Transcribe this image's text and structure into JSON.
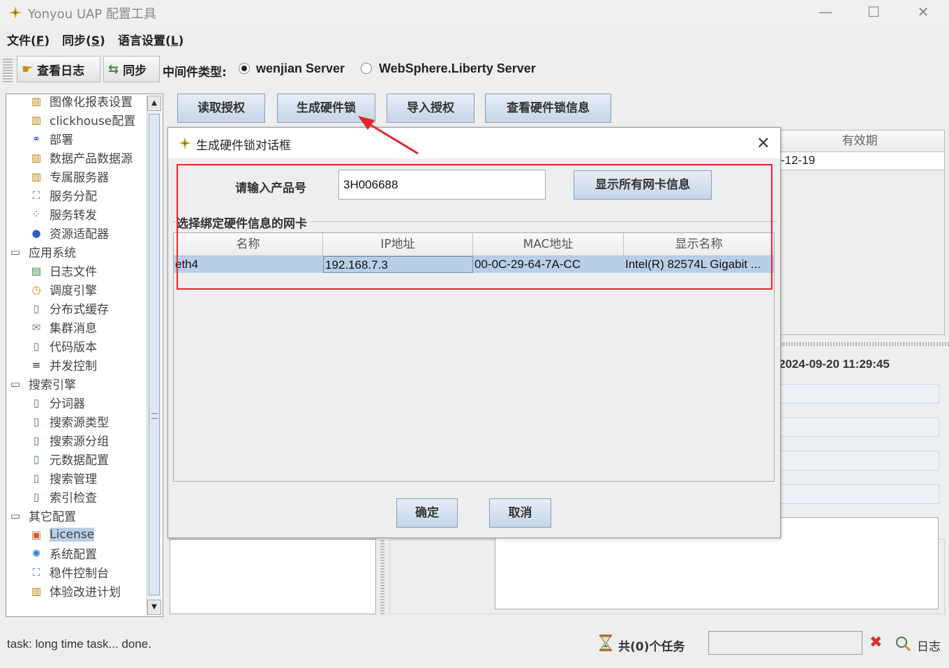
{
  "window": {
    "title": "Yonyou UAP 配置工具",
    "controls": [
      "—",
      "☐",
      "✕"
    ]
  },
  "menubar": {
    "items": [
      {
        "label": "文件(",
        "key": "F",
        "end": ")"
      },
      {
        "label": "同步(",
        "key": "S",
        "end": ")"
      },
      {
        "label": "语言设置(",
        "key": "L",
        "end": ")"
      }
    ]
  },
  "toolbar": {
    "view_log": "查看日志",
    "sync": "同步",
    "middleware_label": "中间件类型:",
    "radio_options": [
      {
        "label": "wenjian Server",
        "selected": true
      },
      {
        "label": "WebSphere.Liberty Server",
        "selected": false
      }
    ]
  },
  "tree": {
    "items": [
      {
        "label": "图像化报表设置",
        "icon": "config-icon",
        "level": 1
      },
      {
        "label": "clickhouse配置",
        "icon": "config-icon",
        "level": 1
      },
      {
        "label": "部署",
        "icon": "deploy-icon",
        "level": 1
      },
      {
        "label": "数据产品数据源",
        "icon": "config-icon",
        "level": 1
      },
      {
        "label": "专属服务器",
        "icon": "config-icon",
        "level": 1
      },
      {
        "label": "服务分配",
        "icon": "network-icon",
        "level": 1
      },
      {
        "label": "服务转发",
        "icon": "forward-icon",
        "level": 1
      },
      {
        "label": "资源适配器",
        "icon": "adapter-icon",
        "level": 1
      },
      {
        "label": "应用系统",
        "icon": "folder-icon",
        "level": 0
      },
      {
        "label": "日志文件",
        "icon": "log-file-icon",
        "level": 1
      },
      {
        "label": "调度引擎",
        "icon": "clock-icon",
        "level": 1
      },
      {
        "label": "分布式缓存",
        "icon": "document-icon",
        "level": 1
      },
      {
        "label": "集群消息",
        "icon": "mail-icon",
        "level": 1
      },
      {
        "label": "代码版本",
        "icon": "document-icon",
        "level": 1
      },
      {
        "label": "并发控制",
        "icon": "lines-icon",
        "level": 1
      },
      {
        "label": "搜索引擎",
        "icon": "folder-icon",
        "level": 0
      },
      {
        "label": "分词器",
        "icon": "document-icon",
        "level": 1
      },
      {
        "label": "搜索源类型",
        "icon": "document-icon",
        "level": 1
      },
      {
        "label": "搜索源分组",
        "icon": "document-icon",
        "level": 1
      },
      {
        "label": "元数据配置",
        "icon": "document-icon",
        "level": 1
      },
      {
        "label": "搜索管理",
        "icon": "document-icon",
        "level": 1
      },
      {
        "label": "索引检查",
        "icon": "document-icon",
        "level": 1
      },
      {
        "label": "其它配置",
        "icon": "folder-icon",
        "level": 0
      },
      {
        "label": "License",
        "icon": "license-icon",
        "level": 1,
        "selected": true
      },
      {
        "label": "系统配置",
        "icon": "gear-icon",
        "level": 1
      },
      {
        "label": "稳件控制台",
        "icon": "network-icon",
        "level": 1
      },
      {
        "label": "体验改进计划",
        "icon": "config-icon",
        "level": 1
      }
    ]
  },
  "main": {
    "buttons": {
      "read_license": "读取授权",
      "generate_lock": "生成硬件锁",
      "import_license": "导入授权",
      "view_lock_info": "查看硬件锁信息"
    },
    "bg_table_header": "有效期",
    "bg_table_cell": "-12-19",
    "bg_timestamp": "2024-09-20 11:29:45"
  },
  "dialog": {
    "title": "生成硬件锁对话框",
    "product_label": "请输入产品号",
    "product_value": "3H006688",
    "show_all_nics": "显示所有网卡信息",
    "nic_group_label": "选择绑定硬件信息的网卡",
    "columns": [
      "名称",
      "IP地址",
      "MAC地址",
      "显示名称"
    ],
    "rows": [
      [
        "eth4",
        "192.168.7.3",
        "00-0C-29-64-7A-CC",
        "Intel(R) 82574L Gigabit ..."
      ]
    ],
    "ok": "确定",
    "cancel": "取消"
  },
  "statusbar": {
    "message": "task: long time task... done.",
    "task_count": "共(0)个任务",
    "log": "日志"
  },
  "colors": {
    "annotation_red": "#e0262a",
    "selection_blue": "#b9cfe8"
  }
}
